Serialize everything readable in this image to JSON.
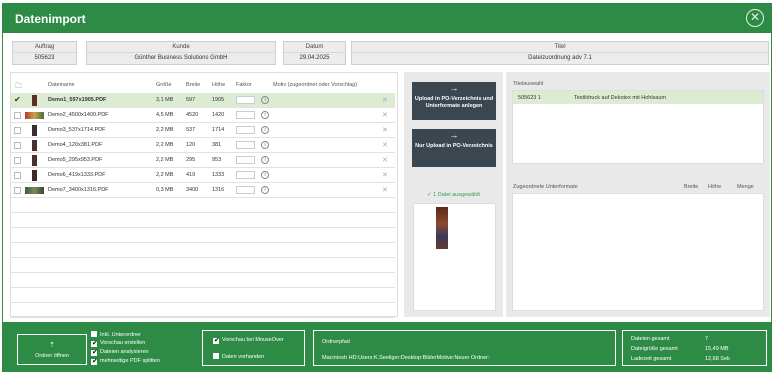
{
  "window": {
    "title": "Datenimport"
  },
  "header": {
    "auftrag": {
      "label": "Auftrag",
      "value": "505623"
    },
    "kunde": {
      "label": "Kunde",
      "value": "Günther Business Solutions GmbH"
    },
    "datum": {
      "label": "Datum",
      "value": "29.04.2025"
    },
    "titel": {
      "label": "Titel",
      "value": "Dateizuordnung adv 7.1"
    }
  },
  "files": {
    "columns": {
      "name": "Dateiname",
      "size": "Größe",
      "width": "Breite",
      "height": "Höhe",
      "factor": "Faktor",
      "motif": "Motiv (zugeordnet oder Vorschlag)"
    },
    "rows": [
      {
        "name": "Demo1_597x1905.PDF",
        "size": "3,1 MB",
        "width": "597",
        "height": "1905",
        "selected": true
      },
      {
        "name": "Demo2_4500x1400.PDF",
        "size": "4,5 MB",
        "width": "4520",
        "height": "1420",
        "selected": false
      },
      {
        "name": "Demo3_537x1714.PDF",
        "size": "2,2 MB",
        "width": "537",
        "height": "1714",
        "selected": false
      },
      {
        "name": "Demo4_120x381.PDF",
        "size": "2,2 MB",
        "width": "120",
        "height": "381",
        "selected": false
      },
      {
        "name": "Demo5_295x953.PDF",
        "size": "2,2 MB",
        "width": "295",
        "height": "953",
        "selected": false
      },
      {
        "name": "Demo6_419x1333.PDF",
        "size": "2,2 MB",
        "width": "419",
        "height": "1333",
        "selected": false
      },
      {
        "name": "Demo7_3400x1316.PDF",
        "size": "0,3 MB",
        "width": "3400",
        "height": "1316",
        "selected": false
      }
    ]
  },
  "upload": {
    "btn1": "Upload in PO-Verzeichnis und Unterformate anlegen",
    "btn2": "Nur Upload in PO-Verzeichnis",
    "selected_info": "1 Datei ausgewählt"
  },
  "titles": {
    "header": "Titelauswahl",
    "rows": [
      {
        "id": "505623 1",
        "name": "Textildruck auf Dekotex mit Hohlsaum"
      }
    ]
  },
  "subformats": {
    "header": "Zugeordnete Unterformate",
    "width": "Breite",
    "height": "Höhe",
    "qty": "Menge"
  },
  "footer": {
    "open_folder": "Ordner öffnen",
    "opt_subfolders": "Inkl. Unterordner",
    "opt_preview": "Vorschau erstellen",
    "opt_analyze": "Dateien analysieren",
    "opt_split": "mehrseitige PDF splitten",
    "opt_mouseover": "Vorschau bei MouseOver",
    "opt_exists": "Daten vorhanden",
    "path_label": "Ordnerpfad",
    "path_value": "Macintosh HD:Users:K.Seeliger:Desktop:BilderMotive:Neuer Ordner:",
    "stats": [
      {
        "label": "Dateien gesamt",
        "value": "7"
      },
      {
        "label": "Dateigröße gesamt",
        "value": "15,49 MB"
      },
      {
        "label": "Ladezeit gesamt",
        "value": "12,68 Sek"
      }
    ]
  },
  "colors": {
    "brand_green": "#2e8b46",
    "dark_button": "#3a4750",
    "selected_row": "#dcecd3"
  }
}
